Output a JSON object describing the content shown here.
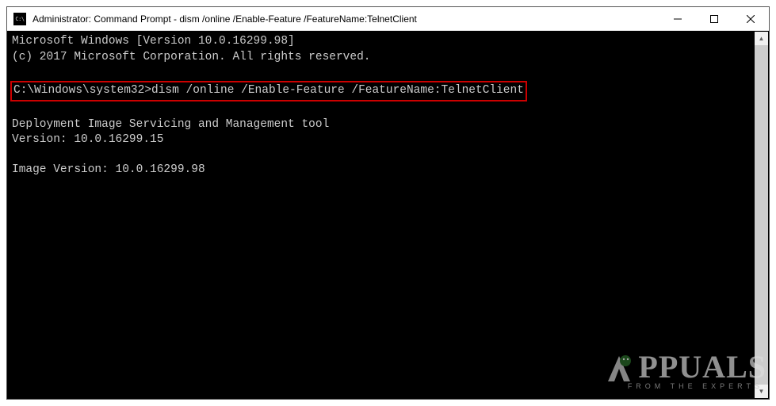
{
  "window": {
    "title": "Administrator: Command Prompt - dism  /online /Enable-Feature /FeatureName:TelnetClient"
  },
  "terminal": {
    "header1": "Microsoft Windows [Version 10.0.16299.98]",
    "header2": "(c) 2017 Microsoft Corporation. All rights reserved.",
    "prompt": "C:\\Windows\\system32>",
    "command": "dism /online /Enable-Feature /FeatureName:TelnetClient",
    "out1": "Deployment Image Servicing and Management tool",
    "out2": "Version: 10.0.16299.15",
    "out3": "Image Version: 10.0.16299.98"
  },
  "watermark": {
    "brand_rest": "PPUALS",
    "tagline": "FROM THE EXPERTS"
  }
}
